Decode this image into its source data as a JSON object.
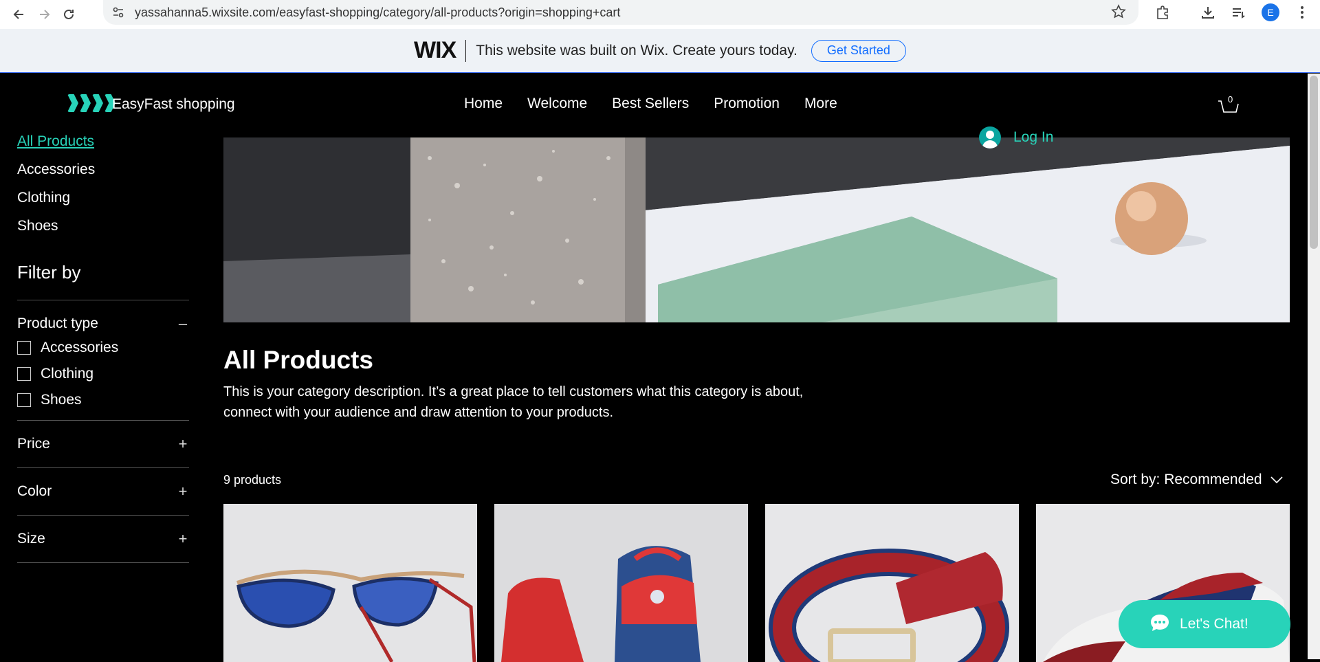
{
  "browser": {
    "url": "yassahanna5.wixsite.com/easyfast-shopping/category/all-products?origin=shopping+cart",
    "profile_initial": "E",
    "icons": [
      "back-icon",
      "forward-icon",
      "reload-icon",
      "site-info-icon",
      "bookmark-star-icon",
      "extensions-icon",
      "download-icon",
      "reading-list-icon",
      "menu-dots-icon"
    ]
  },
  "wix_banner": {
    "logo": "WIX",
    "text": "This website was built on Wix. Create yours today.",
    "button": "Get Started"
  },
  "header": {
    "brand": "EasyFast shopping",
    "nav": [
      "Home",
      "Welcome",
      "Best Sellers",
      "Promotion",
      "More"
    ],
    "cart_count": "0",
    "login": "Log In"
  },
  "sidebar": {
    "categories": [
      {
        "label": "All Products",
        "active": true
      },
      {
        "label": "Accessories",
        "active": false
      },
      {
        "label": "Clothing",
        "active": false
      },
      {
        "label": "Shoes",
        "active": false
      }
    ],
    "filter_title": "Filter by",
    "product_type": {
      "label": "Product type",
      "control": "–",
      "options": [
        "Accessories",
        "Clothing",
        "Shoes"
      ]
    },
    "price": {
      "label": "Price",
      "control": "+"
    },
    "color": {
      "label": "Color",
      "control": "+"
    },
    "size": {
      "label": "Size",
      "control": "+"
    }
  },
  "category": {
    "title": "All Products",
    "description": "This is your category description. It’s a great place to tell customers what this category is about, connect with your audience and draw attention to your products.",
    "count": "9 products",
    "sort": "Sort by: Recommended"
  },
  "products": [
    {
      "name": "sunglasses-image"
    },
    {
      "name": "backpack-image"
    },
    {
      "name": "belt-image"
    },
    {
      "name": "shoe-image"
    }
  ],
  "chat": {
    "label": "Let's Chat!"
  },
  "colors": {
    "accent": "#28d3b9",
    "wix_blue": "#116dff",
    "background": "#000000"
  }
}
